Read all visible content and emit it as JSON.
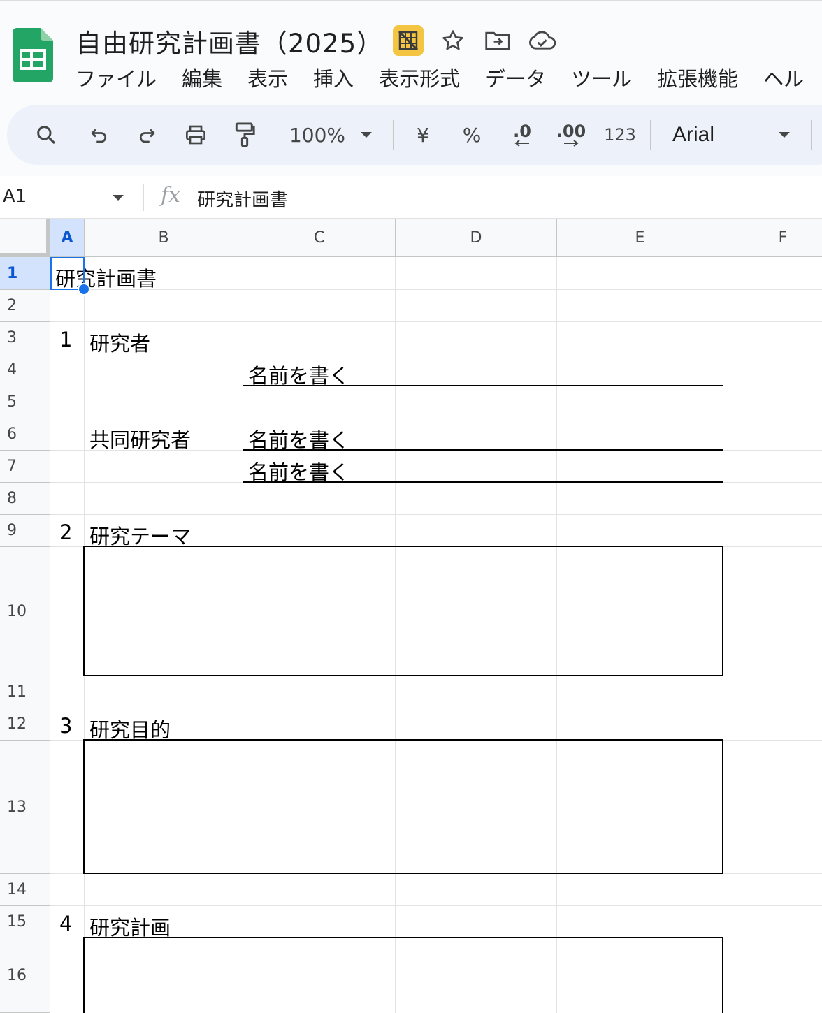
{
  "doc": {
    "title": "自由研究計画書（2025）"
  },
  "menu": [
    "ファイル",
    "編集",
    "表示",
    "挿入",
    "表示形式",
    "データ",
    "ツール",
    "拡張機能",
    "ヘル"
  ],
  "toolbar": {
    "zoom": "100%",
    "currency": "¥",
    "percent": "%",
    "dec_decrease": ".0",
    "dec_increase": ".00",
    "number_format": "123",
    "font": "Arial"
  },
  "formula_bar": {
    "name_box": "A1",
    "fx": "fx",
    "content": "研究計画書"
  },
  "columns": [
    "A",
    "B",
    "C",
    "D",
    "E",
    "F"
  ],
  "rows": [
    "1",
    "2",
    "3",
    "4",
    "5",
    "6",
    "7",
    "8",
    "9",
    "10",
    "11",
    "12",
    "13",
    "14",
    "15",
    "16"
  ],
  "cells": {
    "a1": "研究計画書",
    "a3": "1",
    "b3": "研究者",
    "c4": "名前を書く",
    "b6": "共同研究者",
    "c6": "名前を書く",
    "c7": "名前を書く",
    "a9": "2",
    "b9": "研究テーマ",
    "a12": "3",
    "b12": "研究目的",
    "a15": "4",
    "b15": "研究計画"
  },
  "colors": {
    "sheets_green": "#23a566",
    "selection": "#1a73e8",
    "header_selected": "#d3e3fd",
    "badge": "#f4c542"
  }
}
